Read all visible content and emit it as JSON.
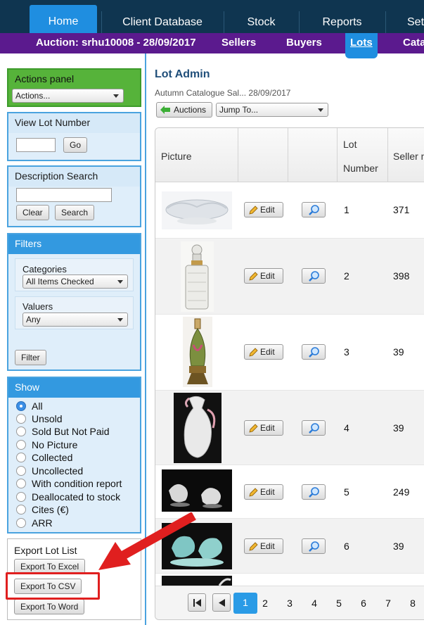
{
  "topnav": {
    "tabs": [
      "Home",
      "Client Database",
      "Stock",
      "Reports",
      "Set"
    ]
  },
  "subnav": {
    "items": [
      "Auction: srhu10008 - 28/09/2017",
      "Sellers",
      "Buyers",
      "Lots",
      "Cata"
    ]
  },
  "actions_panel": {
    "title": "Actions panel",
    "select": "Actions..."
  },
  "view_lot": {
    "title": "View Lot Number",
    "go": "Go"
  },
  "desc_search": {
    "title": "Description Search",
    "clear": "Clear",
    "search": "Search"
  },
  "filters": {
    "title": "Filters",
    "categories_label": "Categories",
    "categories_value": "All Items Checked",
    "valuers_label": "Valuers",
    "valuers_value": "Any",
    "filter_button": "Filter"
  },
  "show": {
    "title": "Show",
    "options": [
      "All",
      "Unsold",
      "Sold But Not Paid",
      "No Picture",
      "Collected",
      "Uncollected",
      "With condition report",
      "Deallocated to stock",
      "Cites (€)",
      "ARR"
    ],
    "selected": "All"
  },
  "export": {
    "title": "Export Lot List",
    "excel": "Export To Excel",
    "csv": "Export To CSV",
    "word": "Export To Word"
  },
  "main": {
    "title": "Lot Admin",
    "subtitle": "Autumn Catalogue Sal...  28/09/2017",
    "auctions_button": "Auctions",
    "jump_select": "Jump To..."
  },
  "table": {
    "headers": {
      "picture": "Picture",
      "lot_line1": "Lot",
      "lot_line2": "Number",
      "seller": "Seller n"
    },
    "edit_label": "Edit",
    "rows": [
      {
        "lot": "1",
        "seller": "371"
      },
      {
        "lot": "2",
        "seller": "398"
      },
      {
        "lot": "3",
        "seller": "39"
      },
      {
        "lot": "4",
        "seller": "39"
      },
      {
        "lot": "5",
        "seller": "249"
      },
      {
        "lot": "6",
        "seller": "39"
      }
    ]
  },
  "pager": {
    "pages": [
      "1",
      "2",
      "3",
      "4",
      "5",
      "6",
      "7",
      "8"
    ],
    "current": "1"
  },
  "colors": {
    "nav": "#0f3550",
    "subnav": "#5b1a8e",
    "accent": "#1f8ee0",
    "annotation": "#e01f1f"
  }
}
